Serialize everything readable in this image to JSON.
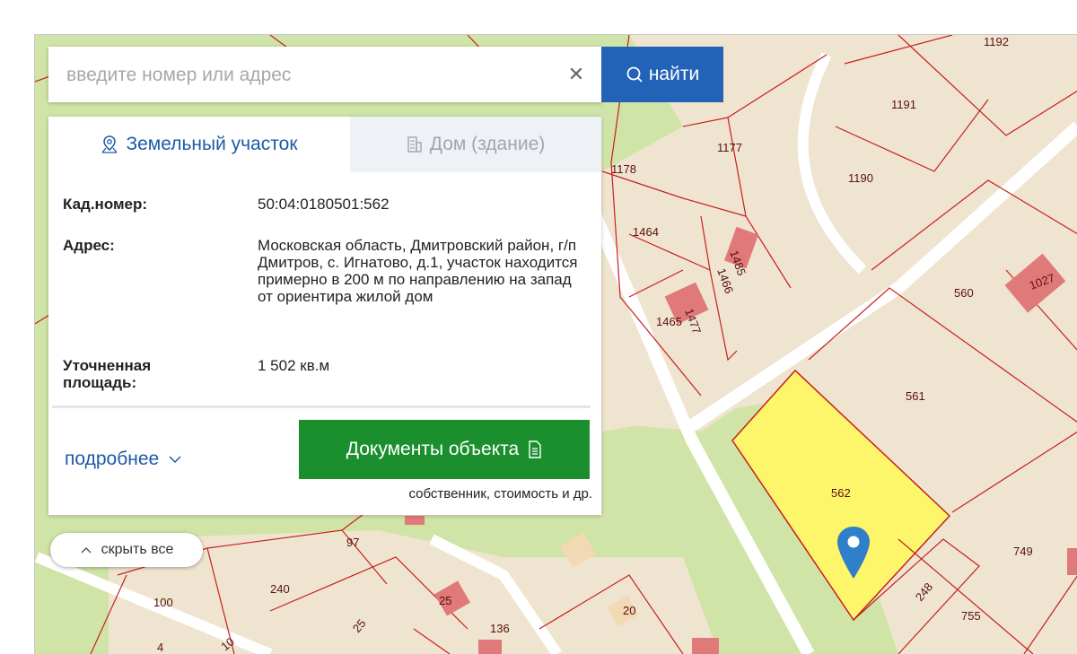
{
  "search": {
    "placeholder": "введите номер или адрес",
    "clear_icon": "close-icon",
    "button_label": "найти",
    "button_icon": "search-icon",
    "button_color": "#2263b8"
  },
  "tabs": [
    {
      "label": "Земельный участок",
      "icon": "land-plot-icon",
      "active": true
    },
    {
      "label": "Дом (здание)",
      "icon": "building-icon",
      "active": false
    }
  ],
  "details": {
    "cad_label": "Кад.номер:",
    "cad_value": "50:04:0180501:562",
    "address_label": "Адрес:",
    "address_value": "Московская область, Дмитровский район, г/п Дмитров, с. Игнатово, д.1, участок находится примерно в 200 м по направлению на запад от ориентира жилой дом",
    "area_label": "Уточненная площадь:",
    "area_value": "1 502 кв.м"
  },
  "actions": {
    "more_label": "подробнее",
    "docs_label": "Документы объекта",
    "docs_subtitle": "собственник, стоимость и др.",
    "docs_color": "#1b8f2e"
  },
  "hide_all_label": "скрыть все",
  "map": {
    "selected_plot": "562",
    "selected_color": "#fdf56a",
    "plot_labels": [
      "1192",
      "1191",
      "1177",
      "1178",
      "1190",
      "1464",
      "1485",
      "1466",
      "1465",
      "1477",
      "560",
      "1027",
      "561",
      "562",
      "749",
      "248",
      "755",
      "97",
      "240",
      "100",
      "25",
      "136",
      "20",
      "25",
      "4",
      "10"
    ]
  }
}
